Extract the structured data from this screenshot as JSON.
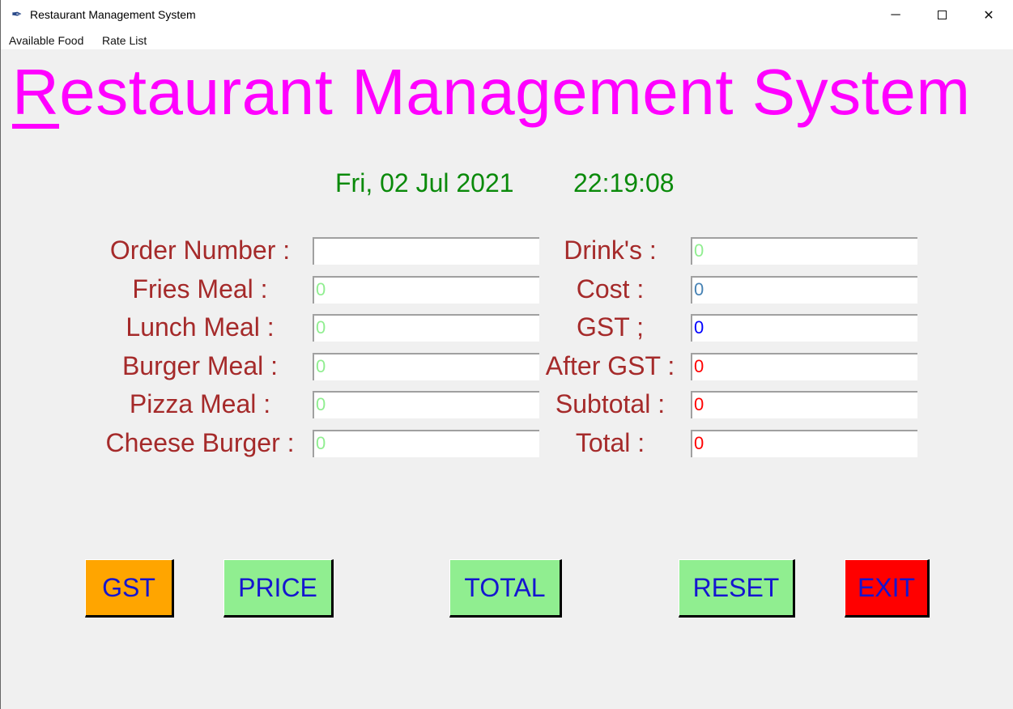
{
  "window": {
    "title": "Restaurant Management System",
    "icon": "feather-icon"
  },
  "menu": [
    "Available Food",
    "Rate List"
  ],
  "heading": {
    "first_letter": "R",
    "rest": "estaurant Management System"
  },
  "date": "Fri, 02 Jul 2021",
  "time": "22:19:08",
  "left_fields": [
    {
      "label": "Order Number :",
      "value": "",
      "color": "#000000"
    },
    {
      "label": "Fries Meal :",
      "value": "0",
      "color": "#90ee90"
    },
    {
      "label": "Lunch Meal :",
      "value": "0",
      "color": "#90ee90"
    },
    {
      "label": "Burger Meal :",
      "value": "0",
      "color": "#90ee90"
    },
    {
      "label": "Pizza Meal :",
      "value": "0",
      "color": "#90ee90"
    },
    {
      "label": "Cheese Burger :",
      "value": "0",
      "color": "#90ee90"
    }
  ],
  "right_fields": [
    {
      "label": "Drink's :",
      "value": "0",
      "color": "#90ee90"
    },
    {
      "label": "Cost :",
      "value": "0",
      "color": "#4682b4"
    },
    {
      "label": "GST ;",
      "value": "0",
      "color": "#0000ff"
    },
    {
      "label": "After GST :",
      "value": "0",
      "color": "#ff0000"
    },
    {
      "label": "Subtotal :",
      "value": "0",
      "color": "#ff0000"
    },
    {
      "label": "Total :",
      "value": "0",
      "color": "#ff0000"
    }
  ],
  "buttons": [
    {
      "label": "GST",
      "bg": "#ffa500"
    },
    {
      "label": "PRICE",
      "bg": "#90ee90"
    },
    {
      "label": "TOTAL",
      "bg": "#90ee90"
    },
    {
      "label": "RESET",
      "bg": "#90ee90"
    },
    {
      "label": "EXIT",
      "bg": "#ff0000"
    }
  ]
}
